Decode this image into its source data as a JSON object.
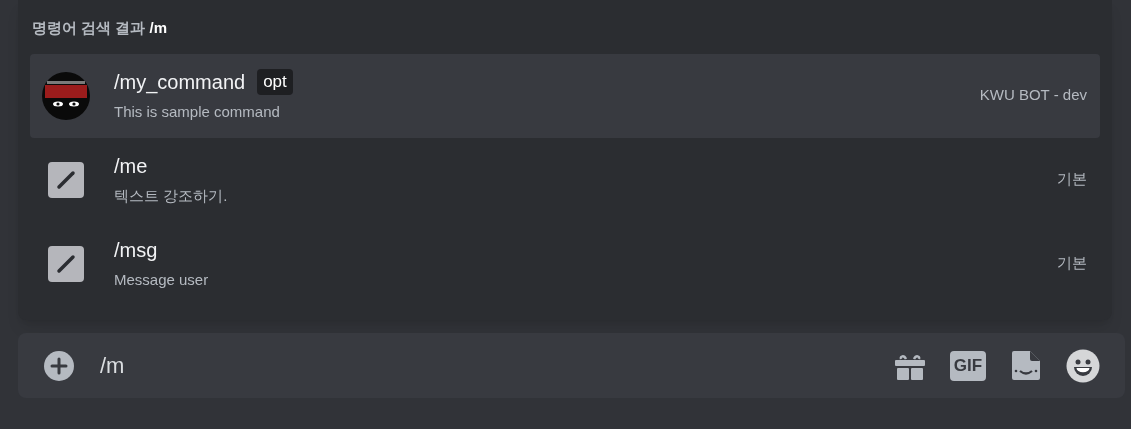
{
  "header": {
    "title": "명령어 검색 결과 ",
    "query": "/m"
  },
  "commands": [
    {
      "kind": "bot",
      "name": "/my_command",
      "option": "opt",
      "description": "This is sample command",
      "source": "KWU BOT - dev",
      "selected": true
    },
    {
      "kind": "builtin",
      "name": "/me",
      "description": "텍스트 강조하기.",
      "source": "기본",
      "selected": false
    },
    {
      "kind": "builtin",
      "name": "/msg",
      "description": "Message user",
      "source": "기본",
      "selected": false
    }
  ],
  "composer": {
    "value": "/m",
    "gif_label": "GIF"
  }
}
